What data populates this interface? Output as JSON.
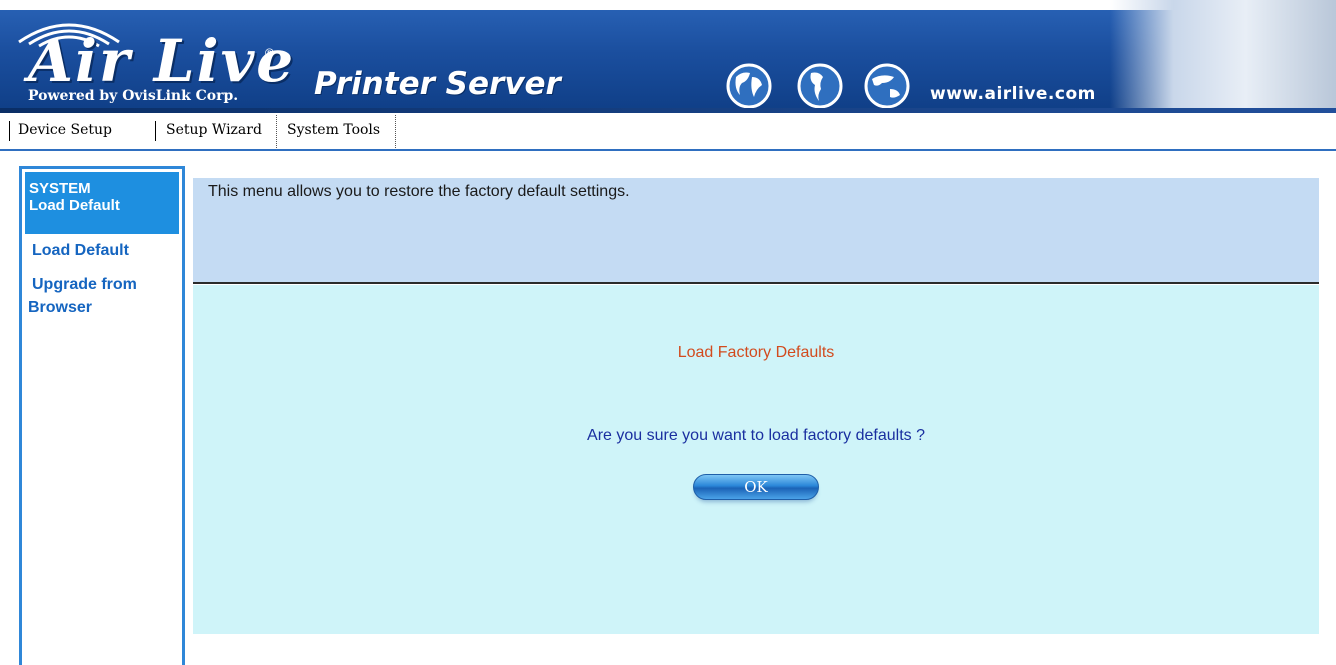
{
  "header": {
    "brand": "Air Live",
    "brand_sub": "Powered by OvisLink Corp.",
    "product": "Printer Server",
    "website": "www.airlive.com",
    "reg_mark": "®"
  },
  "topnav": {
    "items": [
      "Device Setup",
      "Setup Wizard",
      "System Tools"
    ],
    "active": "System Tools"
  },
  "sidebar": {
    "section_line1": "SYSTEM",
    "section_line2": "Load Default",
    "links": [
      "Load Default",
      "Upgrade from",
      "Browser"
    ]
  },
  "main": {
    "info_text": "This menu allows you to restore the factory default settings.",
    "panel_title": "Load Factory Defaults",
    "question": "Are you sure you want to load factory defaults ?",
    "ok_label": "OK"
  },
  "colors": {
    "banner": "#1b4f9f",
    "sidebar_head": "#1e8fe0",
    "info_bg": "#c4dbf3",
    "action_bg": "#cff4f9",
    "title_color": "#d24b1e",
    "question_color": "#1a2fa0"
  },
  "icons": [
    "signal-waves-icon",
    "globe-icon",
    "globe-icon",
    "globe-icon"
  ]
}
